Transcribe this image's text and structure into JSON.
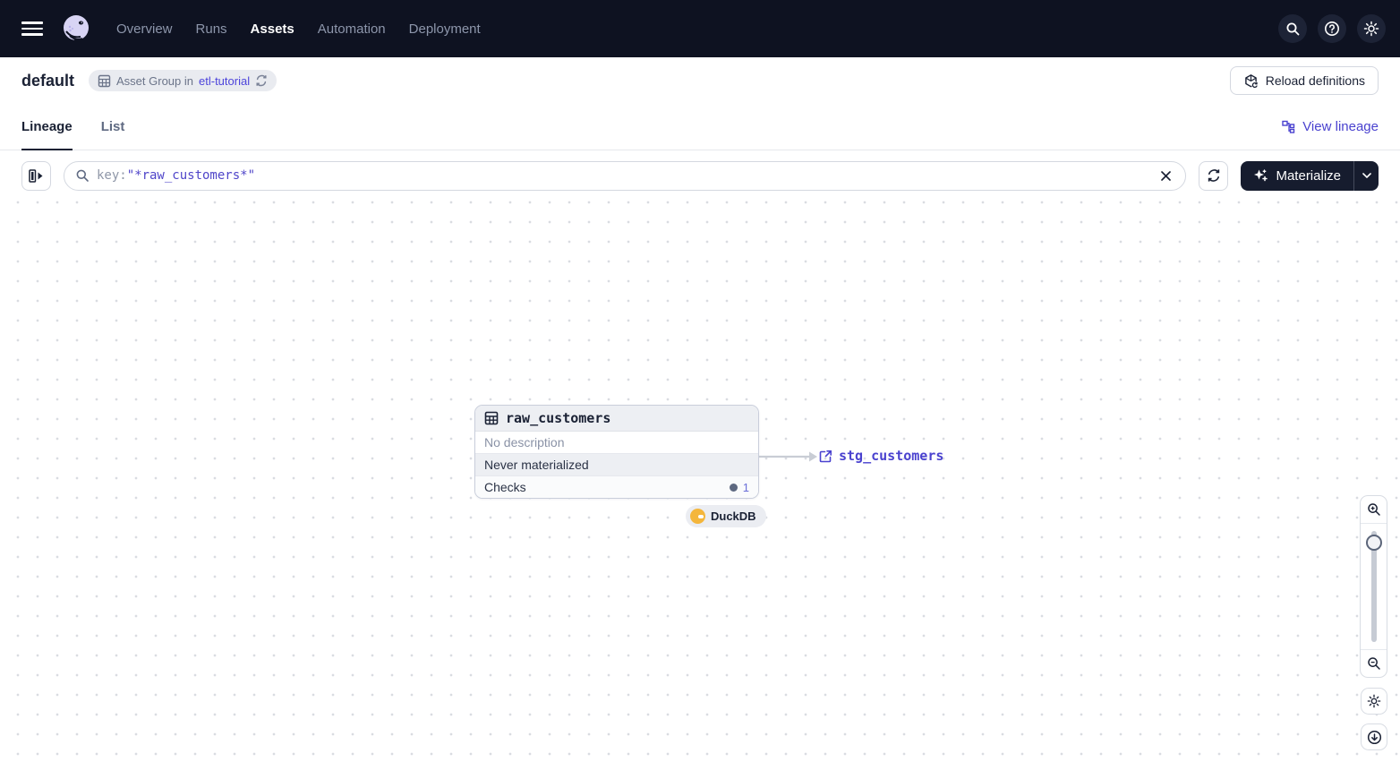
{
  "navbar": {
    "items": [
      {
        "label": "Overview"
      },
      {
        "label": "Runs"
      },
      {
        "label": "Assets"
      },
      {
        "label": "Automation"
      },
      {
        "label": "Deployment"
      }
    ]
  },
  "header": {
    "title": "default",
    "badge": {
      "prefix": "Asset Group in",
      "link": "etl-tutorial"
    },
    "reload_label": "Reload definitions"
  },
  "tabs": {
    "lineage": "Lineage",
    "list": "List",
    "view_lineage": "View lineage"
  },
  "toolbar": {
    "search": {
      "key": "key:",
      "value": "\"*raw_customers*\""
    },
    "materialize_label": "Materialize"
  },
  "graph": {
    "node": {
      "name": "raw_customers",
      "description": "No description",
      "status": "Never materialized",
      "checks_label": "Checks",
      "checks_count": "1",
      "kind_tag": "DuckDB"
    },
    "downstream": {
      "name": "stg_customers"
    }
  },
  "colors": {
    "navbar_bg": "#0e1221",
    "accent_link": "#4a42cf",
    "materialize_bg": "#161c2e",
    "duckdb_yellow": "#f4b63c",
    "node_header_bg": "#edeff3"
  }
}
